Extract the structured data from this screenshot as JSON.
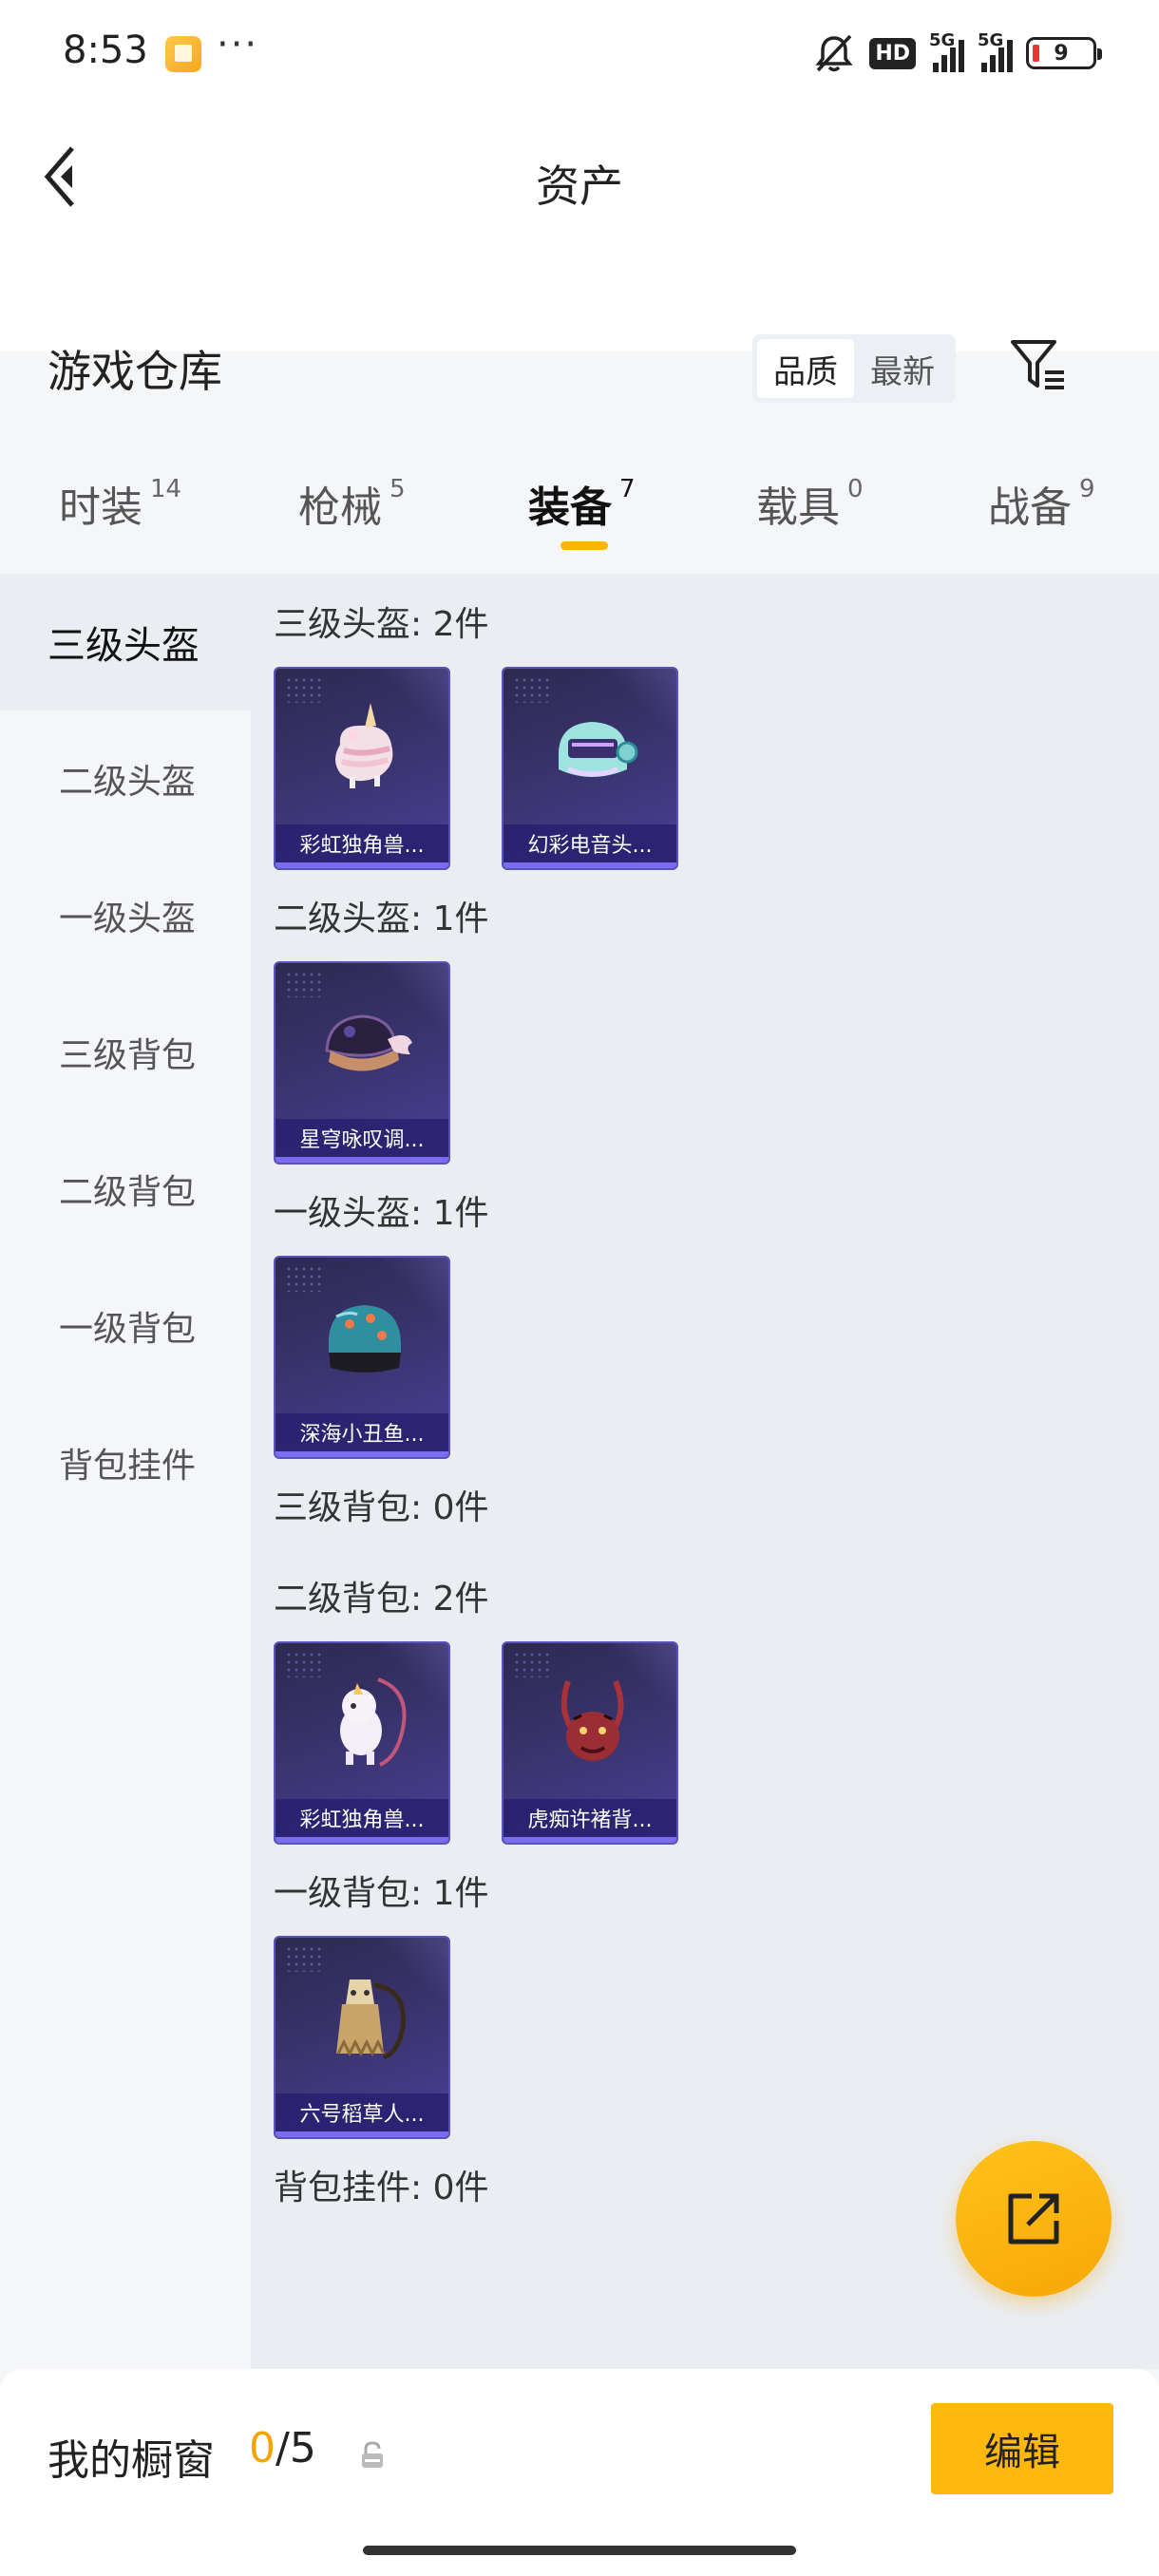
{
  "status_bar": {
    "time": "8:53",
    "more": "···",
    "hd_label": "HD",
    "signal1_label": "5G",
    "signal2_label": "5G",
    "battery": "9"
  },
  "header": {
    "title": "资产",
    "section_title": "游戏仓库",
    "sort_options": [
      "品质",
      "最新"
    ],
    "active_sort": "品质"
  },
  "tabs": [
    {
      "label": "时装",
      "count": "14",
      "active": false
    },
    {
      "label": "枪械",
      "count": "5",
      "active": false
    },
    {
      "label": "装备",
      "count": "7",
      "active": true
    },
    {
      "label": "载具",
      "count": "0",
      "active": false
    },
    {
      "label": "战备",
      "count": "9",
      "active": false
    }
  ],
  "sidebar": {
    "items": [
      {
        "label": "三级头盔",
        "active": true
      },
      {
        "label": "二级头盔",
        "active": false
      },
      {
        "label": "一级头盔",
        "active": false
      },
      {
        "label": "三级背包",
        "active": false
      },
      {
        "label": "二级背包",
        "active": false
      },
      {
        "label": "一级背包",
        "active": false
      },
      {
        "label": "背包挂件",
        "active": false
      }
    ]
  },
  "groups": [
    {
      "label": "三级头盔: 2件",
      "items": [
        {
          "name": "彩虹独角兽...",
          "icon": "unicorn-cake-helmet-icon"
        },
        {
          "name": "幻彩电音头...",
          "icon": "dj-helmet-icon"
        }
      ]
    },
    {
      "label": "二级头盔: 1件",
      "items": [
        {
          "name": "星穹咏叹调...",
          "icon": "winged-helmet-icon"
        }
      ]
    },
    {
      "label": "一级头盔: 1件",
      "items": [
        {
          "name": "深海小丑鱼...",
          "icon": "clownfish-helmet-icon"
        }
      ]
    },
    {
      "label": "三级背包: 0件",
      "items": []
    },
    {
      "label": "二级背包: 2件",
      "items": [
        {
          "name": "彩虹独角兽...",
          "icon": "unicorn-backpack-icon"
        },
        {
          "name": "虎痴许褚背...",
          "icon": "tiger-backpack-icon"
        }
      ]
    },
    {
      "label": "一级背包: 1件",
      "items": [
        {
          "name": "六号稻草人...",
          "icon": "scarecrow-backpack-icon"
        }
      ]
    },
    {
      "label": "背包挂件: 0件",
      "items": []
    }
  ],
  "bottom": {
    "showcase_label": "我的橱窗",
    "showcase_current": "0",
    "showcase_total": "/5",
    "edit_label": "编辑"
  },
  "colors": {
    "accent": "#ffb400",
    "card_bg": "#3a3470",
    "card_border": "#5a54b8"
  }
}
